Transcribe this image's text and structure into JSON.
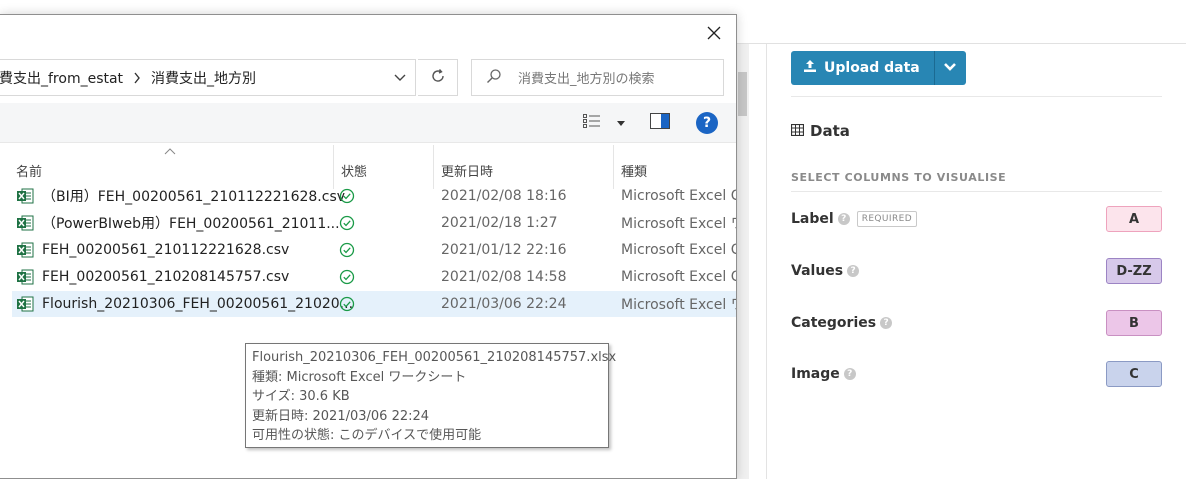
{
  "dialog": {
    "breadcrumb": [
      "費支出_from_estat",
      "消費支出_地方別"
    ],
    "search_placeholder": "消費支出_地方別の検索",
    "help_label": "?",
    "columns": {
      "name": "名前",
      "status": "状態",
      "date": "更新日時",
      "type": "種類"
    },
    "files": [
      {
        "name": "（BI用）FEH_00200561_210112221628.csv",
        "date": "2021/02/08 18:16",
        "type": "Microsoft Excel C"
      },
      {
        "name": "（PowerBIweb用）FEH_00200561_21011...",
        "date": "2021/02/18 1:27",
        "type": "Microsoft Excel ワ"
      },
      {
        "name": "FEH_00200561_210112221628.csv",
        "date": "2021/01/12 22:16",
        "type": "Microsoft Excel C"
      },
      {
        "name": "FEH_00200561_210208145757.csv",
        "date": "2021/02/08 14:58",
        "type": "Microsoft Excel C"
      },
      {
        "name": "Flourish_20210306_FEH_00200561_21020...",
        "date": "2021/03/06 22:24",
        "type": "Microsoft Excel ワ"
      }
    ],
    "tooltip": {
      "line1": "Flourish_20210306_FEH_00200561_210208145757.xlsx",
      "line2": "種類: Microsoft Excel ワークシート",
      "line3": "サイズ: 30.6 KB",
      "line4": "更新日時: 2021/03/06 22:24",
      "line5": "可用性の状態: このデバイスで使用可能"
    }
  },
  "flourish": {
    "upload_label": "Upload data",
    "data_heading": "Data",
    "select_heading": "SELECT COLUMNS TO VISUALISE",
    "help_glyph": "?",
    "required_badge": "REQUIRED",
    "columns": [
      {
        "label": "Label",
        "value": "A",
        "bg": "#fce4ec",
        "border": "#eea3bd"
      },
      {
        "label": "Values",
        "value": "D-ZZ",
        "bg": "#d7c9ea",
        "border": "#9c84c4"
      },
      {
        "label": "Categories",
        "value": "B",
        "bg": "#ecc6e8",
        "border": "#c990c2"
      },
      {
        "label": "Image",
        "value": "C",
        "bg": "#c9d3ec",
        "border": "#8b9ac4"
      }
    ]
  },
  "colors": {
    "upload_blue": "#2886b4",
    "excel_green": "#1f7244",
    "status_green": "#1a9a47",
    "help_blue": "#1b65c4",
    "selected_row": "#e5f1fb"
  }
}
